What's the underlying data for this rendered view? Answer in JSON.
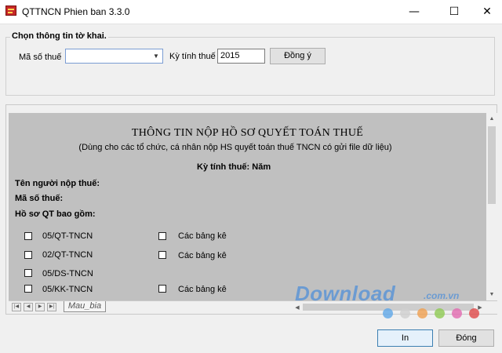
{
  "window": {
    "title": "QTTNCN Phien ban 3.3.0",
    "minimize": "—",
    "maximize": "☐",
    "close": "✕"
  },
  "filter": {
    "group_title": "Chọn thông tin tờ khai.",
    "tax_code_label": "Mã số thuế",
    "tax_code_value": "",
    "period_label": "Kỳ tính thuế",
    "year_value": "2015",
    "agree_button": "Đồng ý"
  },
  "sheet": {
    "title": "THÔNG TIN NỘP HỒ SƠ QUYẾT TOÁN THUẾ",
    "subtitle": "(Dùng cho các tổ chức, cá nhân nộp HS quyết toán thuế TNCN có gửi file dữ liệu)",
    "period_line": "Kỳ tính thuế: Năm",
    "payer_name_label": "Tên người nộp thuế:",
    "payer_tax_label": "Mã số thuế:",
    "dossier_label": "Hồ sơ QT bao gồm:",
    "items_left": [
      "05/QT-TNCN",
      "02/QT-TNCN",
      "05/DS-TNCN",
      "05/KK-TNCN"
    ],
    "items_right": [
      "Các bảng kê",
      "Các bảng kê",
      "Các bảng kê"
    ],
    "tab_name": "Mau_bia"
  },
  "footer": {
    "print_button": "In",
    "close_button": "Đóng"
  },
  "watermark": {
    "text": "Download",
    "suffix": ".com.vn",
    "dot_colors": [
      "#5fa8e8",
      "#d0d0d0",
      "#f0a050",
      "#8ecb52",
      "#e26ab0",
      "#e04848"
    ]
  }
}
